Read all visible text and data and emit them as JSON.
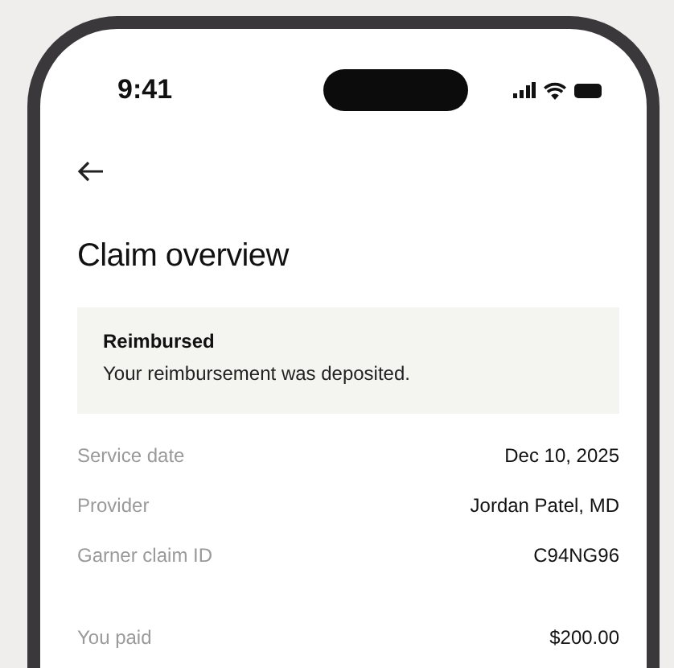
{
  "status_bar": {
    "time": "9:41"
  },
  "title": "Claim overview",
  "status_banner": {
    "heading": "Reimbursed",
    "message": "Your reimbursement was deposited."
  },
  "details": [
    {
      "label": "Service date",
      "value": "Dec 10, 2025"
    },
    {
      "label": "Provider",
      "value": "Jordan Patel, MD"
    },
    {
      "label": "Garner claim ID",
      "value": "C94NG96"
    }
  ],
  "payment": [
    {
      "label": "You paid",
      "value": "$200.00"
    }
  ]
}
